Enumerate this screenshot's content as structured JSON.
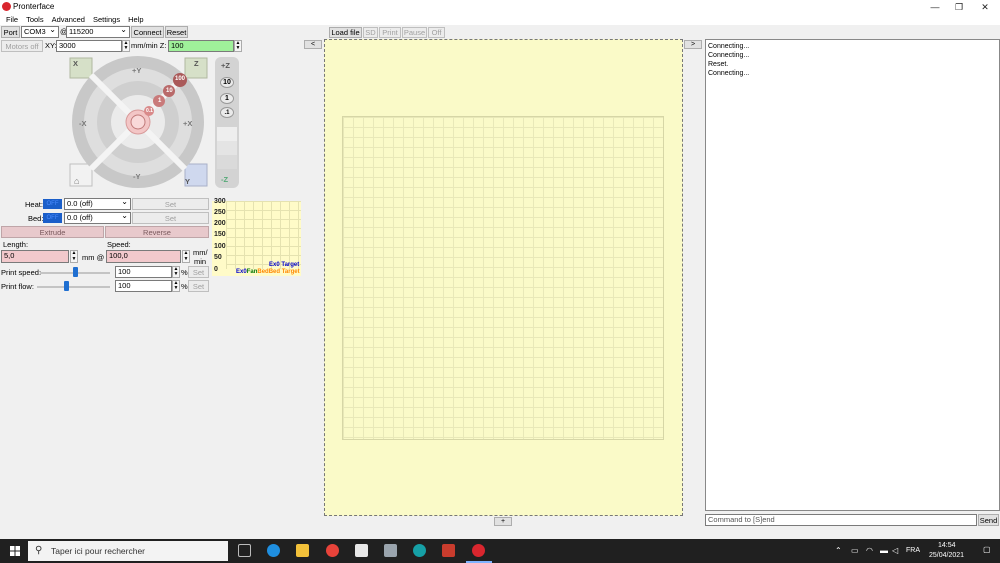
{
  "window": {
    "title": "Pronterface",
    "controls": [
      "—",
      "❐",
      "✕"
    ]
  },
  "menu": [
    "File",
    "Tools",
    "Advanced",
    "Settings",
    "Help"
  ],
  "toolbar": {
    "port_label": "Port",
    "port_value": "COM3",
    "at": "@",
    "baud_value": "115200",
    "connect_label": "Connect",
    "reset_label": "Reset",
    "motors_off_label": "Motors off",
    "xy_label": "XY:",
    "xy_value": "3000",
    "feed_label": "mm/min Z:",
    "z_value": "100"
  },
  "jog": {
    "home_x": "X",
    "home_z": "Z",
    "home_all": "",
    "home_y": "Y",
    "plus_y": "+Y",
    "minus_y": "-Y",
    "plus_x": "+X",
    "minus_x": "-X",
    "step_100": "100",
    "step_10": "10",
    "step_1": "1",
    "step_01": "0.1",
    "z_plus": "+Z",
    "z_minus": "-Z",
    "z_steps": [
      "10",
      "1",
      ".1"
    ]
  },
  "temps": {
    "heat_label": "Heat:",
    "heat_status": "OFF",
    "heat_value": "0.0 (off)",
    "heat_set": "Set",
    "bed_label": "Bed:",
    "bed_status": "OFF",
    "bed_value": "0.0 (off)",
    "bed_set": "Set"
  },
  "extrude": {
    "extrude_label": "Extrude",
    "reverse_label": "Reverse",
    "length_label": "Length:",
    "speed_label": "Speed:",
    "length_value": "5,0",
    "mm_at": "mm @",
    "speed_value": "100,0",
    "unit_top": "mm/",
    "unit_bottom": "min"
  },
  "print_speed": {
    "label": "Print speed:",
    "value": "100",
    "percent": "%",
    "set": "Set",
    "slider_fraction": 0.5
  },
  "print_flow": {
    "label": "Print flow:",
    "value": "100",
    "percent": "%",
    "set": "Set",
    "slider_fraction": 0.4
  },
  "graph": {
    "ticks": [
      "300",
      "250",
      "200",
      "150",
      "100",
      "50",
      "0"
    ],
    "legend_top": "Ex0 Target",
    "legend_bottom": [
      "Ex0",
      "Fan",
      "Bed",
      "Bed Target"
    ],
    "colors": {
      "ex0": "#0000ff",
      "fan": "#008000",
      "bed": "#ff8000",
      "target": "#ff8000"
    }
  },
  "file_toolbar": [
    "Load file",
    "SD",
    "Print",
    "Pause",
    "Off"
  ],
  "viewer": {
    "left_nav": "<",
    "right_nav": ">",
    "bottom_nav": "+"
  },
  "console": {
    "lines": [
      "Connecting...",
      "Connecting...",
      "Reset.",
      "Connecting..."
    ],
    "command_placeholder": "Command to [S]end",
    "send_label": "Send"
  },
  "taskbar": {
    "search_placeholder": "Taper ici pour rechercher",
    "lang": "FRA",
    "time": "14:54",
    "date": "25/04/2021"
  }
}
